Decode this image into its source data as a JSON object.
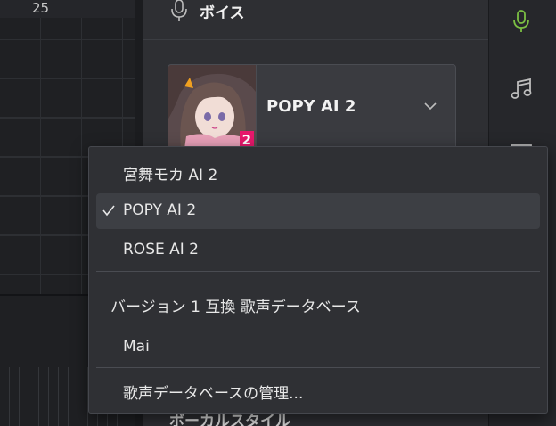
{
  "timeline": {
    "ruler_label": "25"
  },
  "panel": {
    "title": "ボイス",
    "selected_voice": "POPY AI 2",
    "portrait_badge": "2",
    "vocal_style_label": "ボーカルスタイル"
  },
  "menu": {
    "items": [
      {
        "label": "宮舞モカ AI 2",
        "checked": false
      },
      {
        "label": "POPY AI 2",
        "checked": true
      },
      {
        "label": "ROSE AI 2",
        "checked": false
      },
      {
        "label": "バージョン 1 互換 歌声データベース",
        "checked": false
      },
      {
        "label": "Mai",
        "checked": false
      },
      {
        "label": "歌声データベースの管理...",
        "checked": false
      }
    ]
  },
  "rail": {
    "icons": [
      "microphone-icon",
      "music-note-icon",
      "list-icon"
    ]
  },
  "colors": {
    "accent_green": "#7bc043",
    "badge_pink": "#e8186c",
    "menu_bg": "#2f3034",
    "selected_bg": "#3d3f44"
  }
}
